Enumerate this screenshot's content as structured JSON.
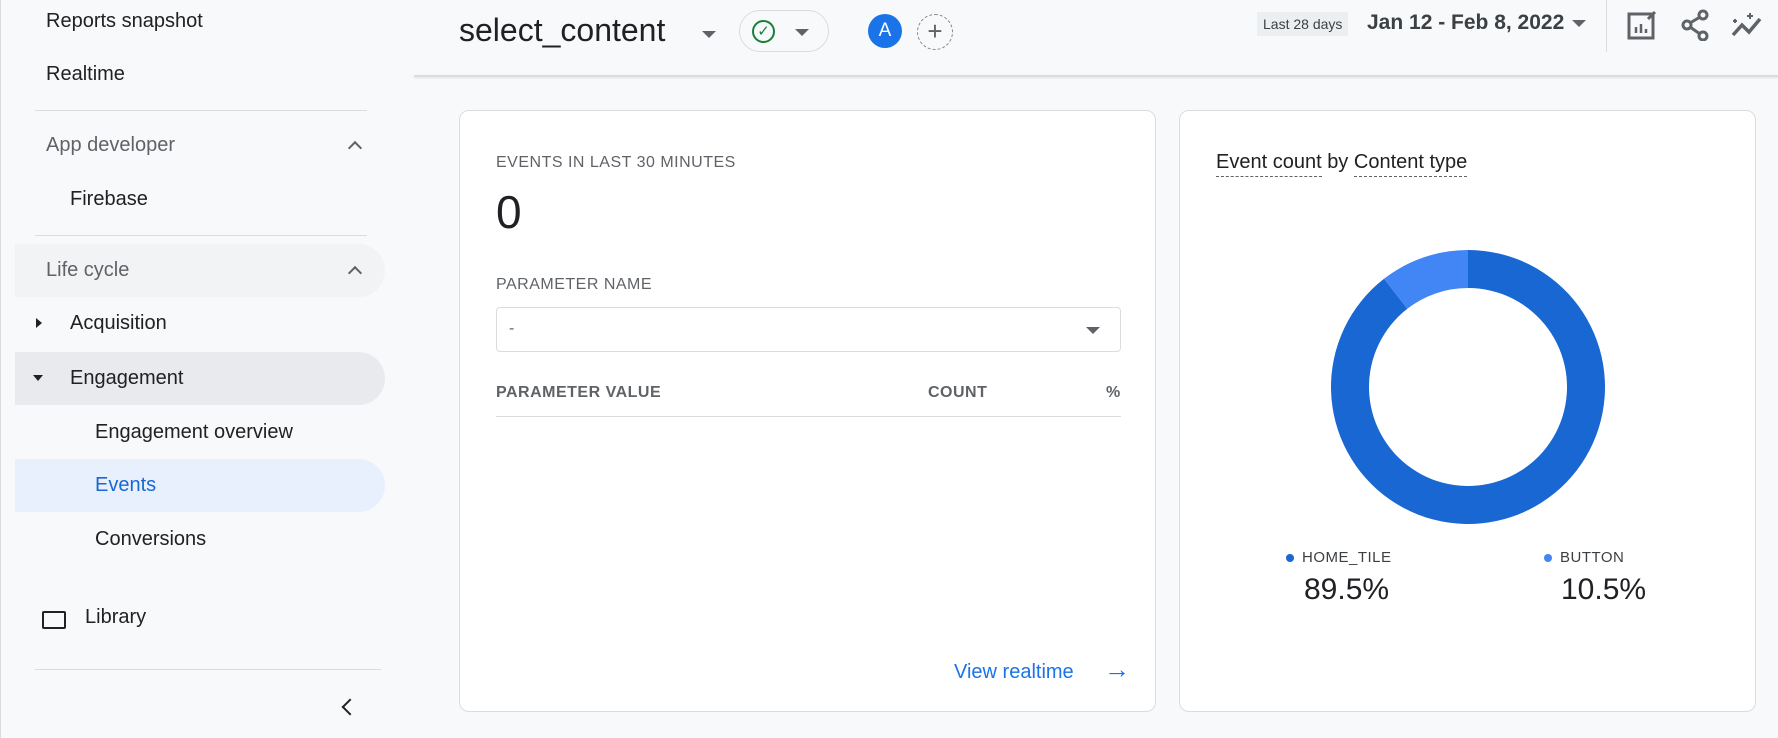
{
  "sidebar": {
    "reports_snapshot": "Reports snapshot",
    "realtime": "Realtime",
    "app_developer": "App developer",
    "firebase": "Firebase",
    "life_cycle": "Life cycle",
    "acquisition": "Acquisition",
    "engagement": "Engagement",
    "engagement_overview": "Engagement overview",
    "events": "Events",
    "conversions": "Conversions",
    "library": "Library"
  },
  "header": {
    "title": "select_content",
    "avatar_letter": "A",
    "date_chip": "Last 28 days",
    "date_range": "Jan 12 - Feb 8, 2022"
  },
  "realtime_card": {
    "events_label": "EVENTS IN LAST 30 MINUTES",
    "events_value": "0",
    "param_name_label": "PARAMETER NAME",
    "param_name_value": "-",
    "col_value": "PARAMETER VALUE",
    "col_count": "COUNT",
    "col_pct": "%",
    "view_realtime": "View realtime"
  },
  "chart_card": {
    "title_metric": "Event count",
    "title_by": "by",
    "title_dimension": "Content type"
  },
  "chart_data": {
    "type": "pie",
    "donut": true,
    "categories": [
      "HOME_TILE",
      "BUTTON"
    ],
    "values": [
      89.5,
      10.5
    ],
    "labels": [
      "89.5%",
      "10.5%"
    ],
    "colors": [
      "#1967d2",
      "#4285f4"
    ]
  }
}
